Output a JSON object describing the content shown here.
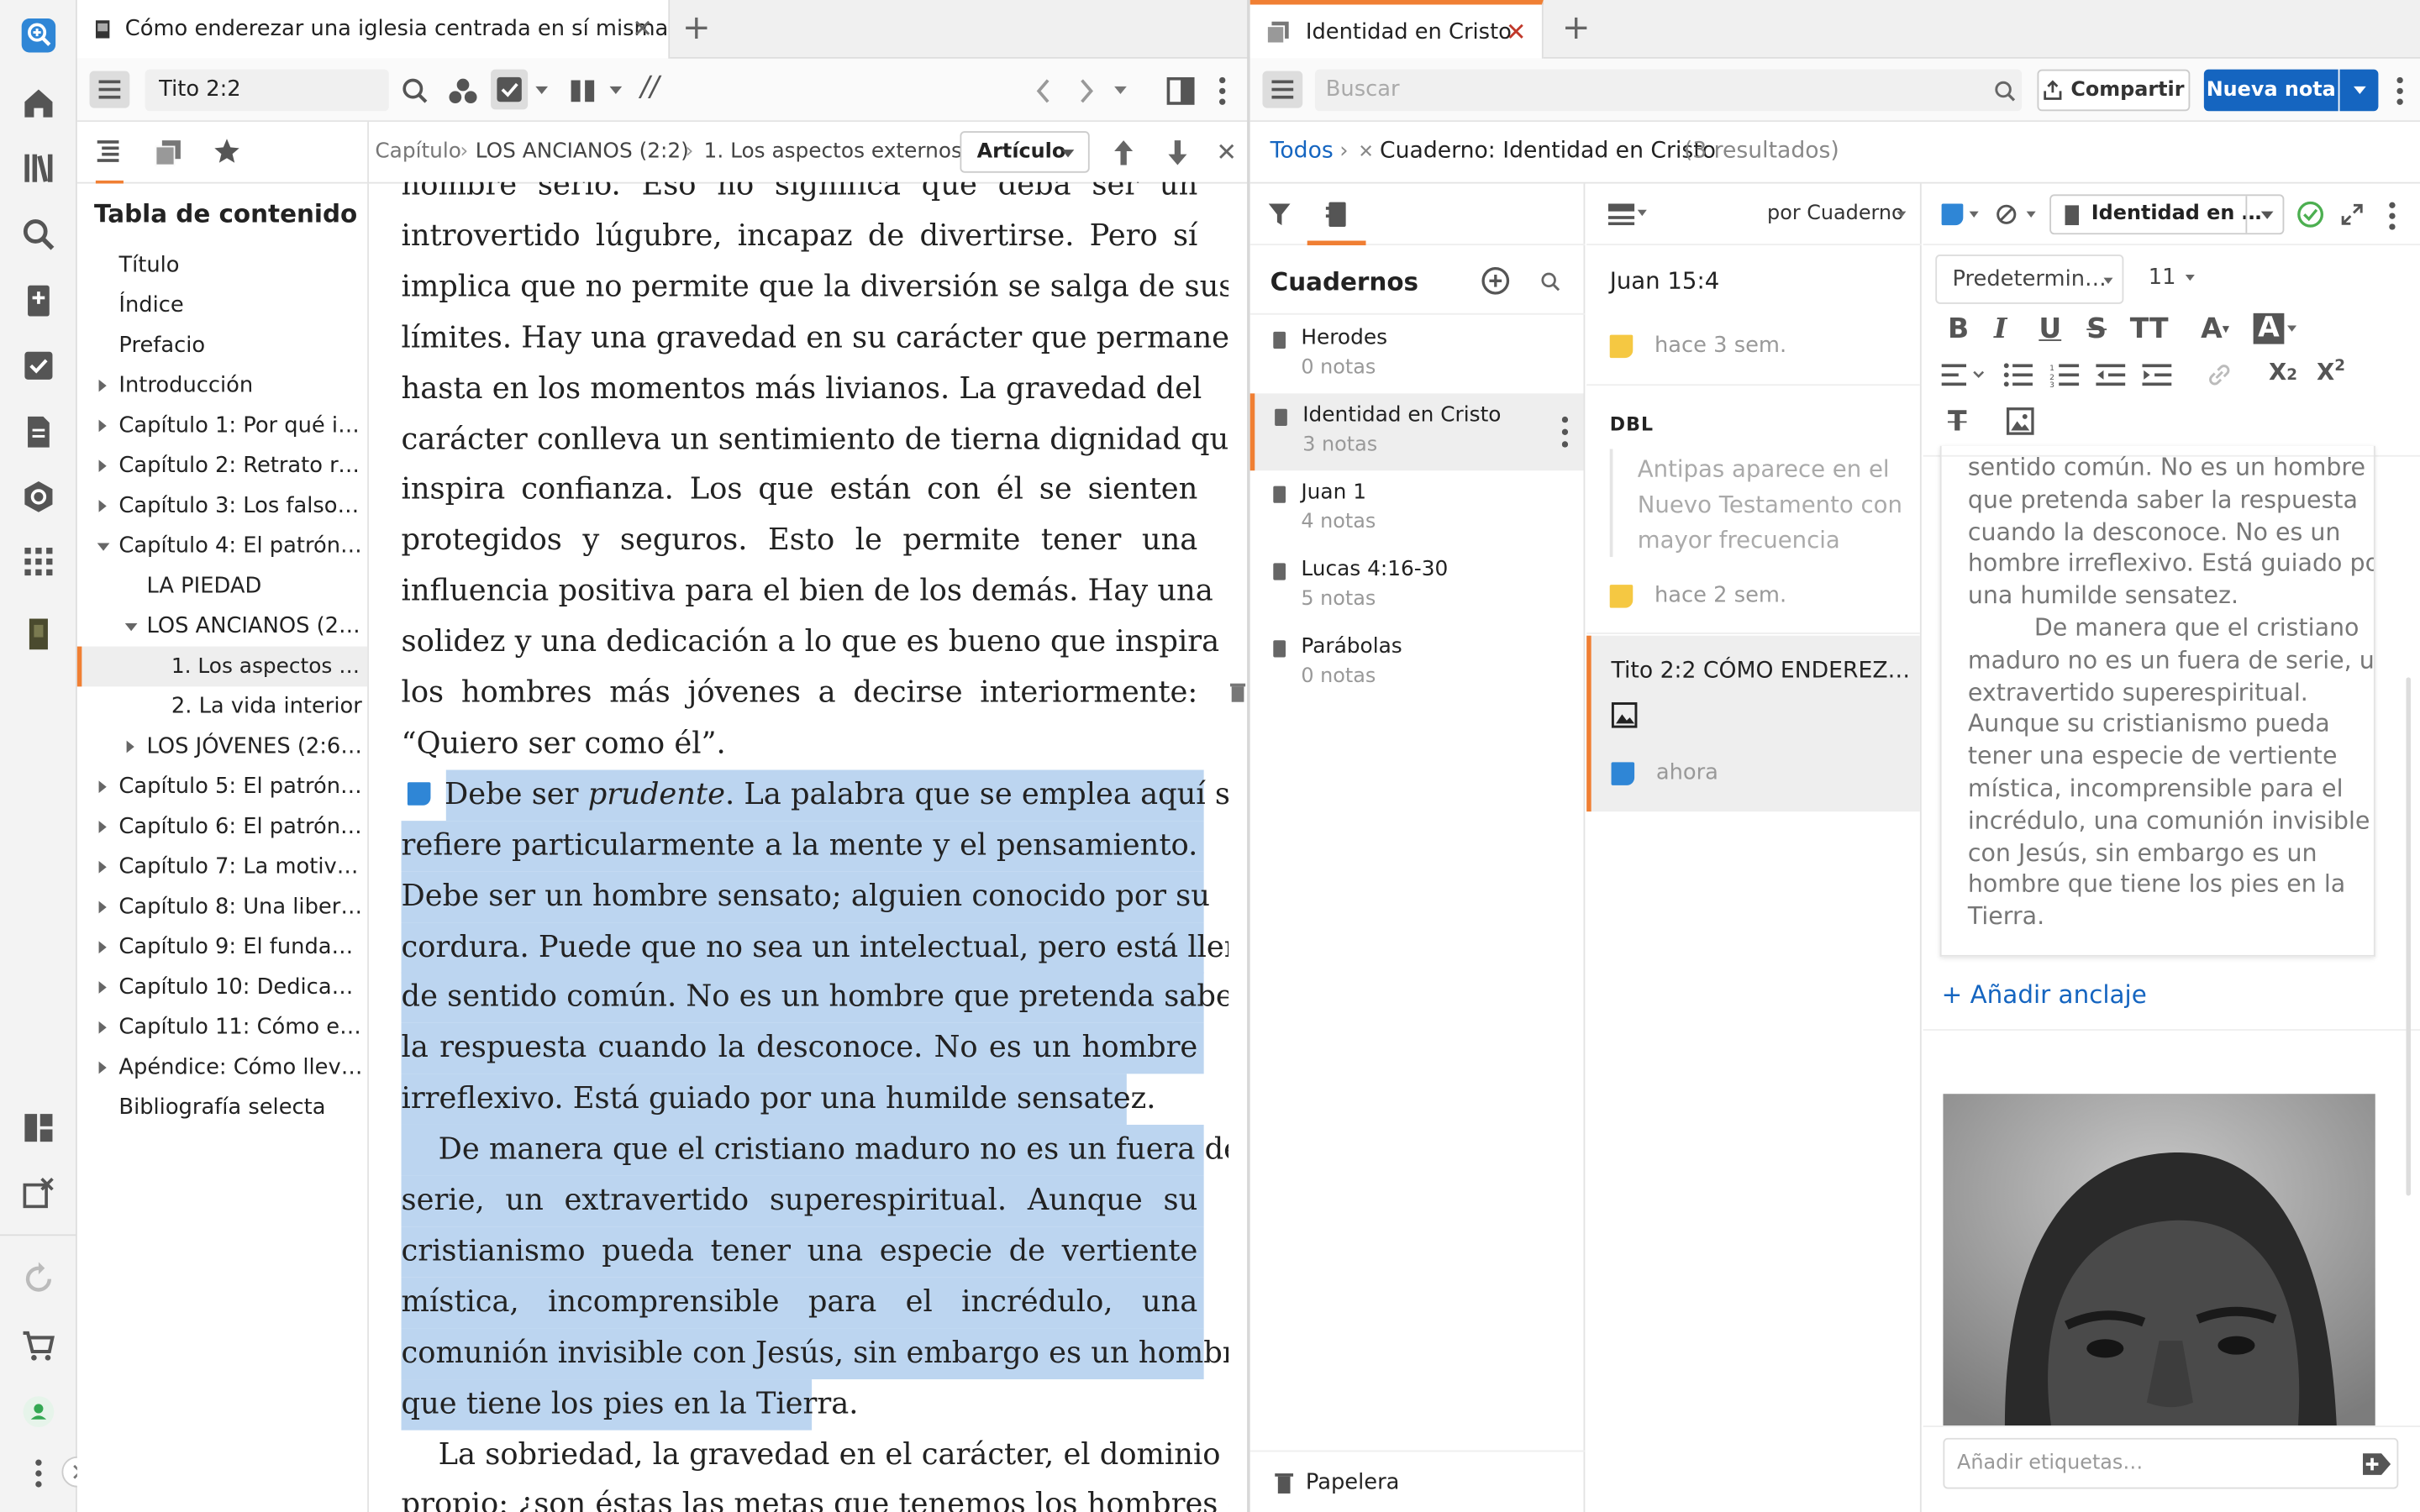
{
  "tabs": {
    "left": {
      "title": "Cómo enderezar una iglesia centrada en sí misma"
    },
    "right": {
      "title": "Identidad en Cristo"
    }
  },
  "toolbar_left": {
    "reference": "Tito 2:2"
  },
  "toolbar_right": {
    "search_placeholder": "Buscar",
    "share_label": "Compartir",
    "new_note_label": "Nueva nota"
  },
  "breadcrumb": {
    "chapter": "Capítulo",
    "section": "LOS ANCIANOS (2:2)",
    "subsection": "1. Los aspectos externos",
    "view_select": "Artículo"
  },
  "toc": {
    "title": "Tabla de contenido",
    "items": [
      {
        "label": "Título"
      },
      {
        "label": "Índice"
      },
      {
        "label": "Prefacio"
      },
      {
        "label": "Introducción"
      },
      {
        "label": "Capítulo 1: Por qué im…"
      },
      {
        "label": "Capítulo 2: Retrato rob…"
      },
      {
        "label": "Capítulo 3: Los falsos…"
      },
      {
        "label": "Capítulo 4: El patrón d…"
      },
      {
        "label": "LA PIEDAD"
      },
      {
        "label": "LOS ANCIANOS (2:2)"
      },
      {
        "label": "1. Los aspectos e…"
      },
      {
        "label": "2. La vida interior"
      },
      {
        "label": "LOS JÓVENES (2:6–8)"
      },
      {
        "label": "Capítulo 5: El patrón en…"
      },
      {
        "label": "Capítulo 6: El patrón d…"
      },
      {
        "label": "Capítulo 7: La motivac…"
      },
      {
        "label": "Capítulo 8: Una liberta…"
      },
      {
        "label": "Capítulo 9: El fundame…"
      },
      {
        "label": "Capítulo 10: Dedicado…"
      },
      {
        "label": "Capítulo 11: Cómo end…"
      },
      {
        "label": "Apéndice: Cómo llevar…"
      },
      {
        "label": "Bibliografía selecta"
      }
    ]
  },
  "reader": {
    "lines": [
      {
        "text": "hombre serio. Eso no significa que deba ser un"
      },
      {
        "text": "introvertido lúgubre, incapaz de divertirse. Pero sí"
      },
      {
        "text": "implica que no permite que la diversión se salga de sus"
      },
      {
        "text": "límites. Hay una gravedad en su carácter que permanece"
      },
      {
        "text": "hasta en los momentos más livianos. La gravedad del"
      },
      {
        "text": "carácter conlleva un sentimiento de tierna dignidad que"
      },
      {
        "text": "inspira confianza. Los que están con él se sienten"
      },
      {
        "text": "protegidos y seguros. Esto le permite tener una"
      },
      {
        "text": "influencia positiva para el bien de los demás. Hay una"
      },
      {
        "text": "solidez y una dedicación a lo que es bueno que inspira a"
      },
      {
        "text": "los hombres más jóvenes a decirse interiormente:"
      },
      {
        "text": "“Quiero ser como él”."
      },
      {
        "text": "Debe ser prudente. La palabra que se emplea aquí se"
      },
      {
        "text": "refiere particularmente a la mente y el pensamiento."
      },
      {
        "text": "Debe ser un hombre sensato; alguien conocido por su"
      },
      {
        "text": "cordura. Puede que no sea un intelectual, pero está lleno"
      },
      {
        "text": "de sentido común. No es un hombre que pretenda saber"
      },
      {
        "text": "la respuesta cuando la desconoce. No es un hombre"
      },
      {
        "text": "irreflexivo. Está guiado por una humilde sensatez."
      },
      {
        "text": "De manera que el cristiano maduro no es un fuera de"
      },
      {
        "text": "serie, un extravertido superespiritual. Aunque su"
      },
      {
        "text": "cristianismo pueda tener una especie de vertiente"
      },
      {
        "text": "mística, incomprensible para el incrédulo, una"
      },
      {
        "text": "comunión invisible con Jesús, sin embargo es un hombre"
      },
      {
        "text": "que tiene los pies en la Tierra."
      },
      {
        "text": "La sobriedad, la gravedad en el carácter, el dominio"
      },
      {
        "text": "propio: ¿son éstas las metas que tenemos los hombres en"
      }
    ]
  },
  "notes": {
    "crumb_all": "Todos",
    "crumb_filter": "Cuaderno: Identidad en Cristo",
    "crumb_count": "(3 resultados)",
    "notebooks_title": "Cuadernos",
    "sort_label": "por Cuaderno",
    "trash_label": "Papelera",
    "notebooks": [
      {
        "name": "Herodes",
        "count": "0 notas"
      },
      {
        "name": "Identidad en Cristo",
        "count": "3 notas"
      },
      {
        "name": "Juan 1",
        "count": "4 notas"
      },
      {
        "name": "Lucas 4:16-30",
        "count": "5 notas"
      },
      {
        "name": "Parábolas",
        "count": "0 notas"
      }
    ],
    "list": [
      {
        "title": "Juan 15:4",
        "time": "hace 3 sem."
      },
      {
        "label": "DBL",
        "excerpt": "Antipas aparece en el Nuevo Testamento con mayor frecuencia",
        "time": "hace 2 sem."
      },
      {
        "title": "Tito 2:2 CÓMO ENDEREZ…",
        "time": "ahora"
      }
    ]
  },
  "editor": {
    "notebook_select": "Identidad en …",
    "style_select": "Predetermin…",
    "size_select": "11",
    "lines": [
      {
        "text": "sentido común. No es un hombre"
      },
      {
        "text": "que pretenda saber la respuesta"
      },
      {
        "text": "cuando la desconoce. No es un"
      },
      {
        "text": "hombre irreflexivo. Está guiado por"
      },
      {
        "text": "una humilde sensatez."
      },
      {
        "text": "De manera que el cristiano"
      },
      {
        "text": "maduro no es un fuera de serie, un"
      },
      {
        "text": "extravertido superespiritual."
      },
      {
        "text": "Aunque su cristianismo pueda"
      },
      {
        "text": "tener una especie de vertiente"
      },
      {
        "text": "mística, incomprensible para el"
      },
      {
        "text": "incrédulo, una comunión invisible"
      },
      {
        "text": "con Jesús, sin embargo es un"
      },
      {
        "text": "hombre que tiene los pies en la"
      },
      {
        "text": "Tierra."
      }
    ],
    "add_anchor": "+ Añadir anclaje",
    "tags_placeholder": "Añadir etiquetas…"
  },
  "colors": {
    "accent": "#1565c0",
    "orange": "#f07f33",
    "highlight": "#bcd5f0",
    "note_yellow": "#f5c842",
    "note_blue": "#2f86d6"
  }
}
